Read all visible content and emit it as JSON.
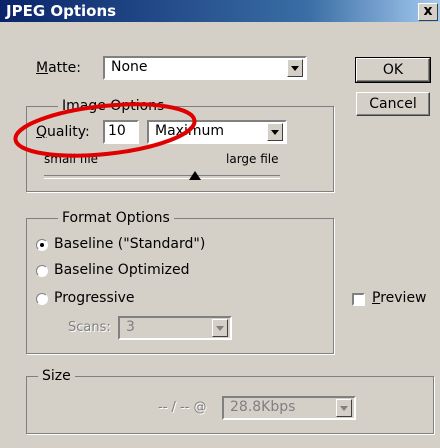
{
  "window": {
    "title": "JPEG Options",
    "close_glyph": "x"
  },
  "matte": {
    "label": "Matte:",
    "underline": "M",
    "rest": "atte:",
    "value": "None"
  },
  "buttons": {
    "ok": "OK",
    "cancel": "Cancel"
  },
  "image_options": {
    "title": "Image Options",
    "quality_underline": "Q",
    "quality_rest": "uality:",
    "quality_value": "10",
    "quality_preset": "Maximum",
    "slider_min_label": "small file",
    "slider_max_label": "large file",
    "slider_level": 0.64
  },
  "format_options": {
    "title": "Format Options",
    "options": [
      {
        "label": "Baseline (\"Standard\")",
        "selected": true
      },
      {
        "label": "Baseline Optimized",
        "selected": false
      },
      {
        "label": "Progressive",
        "selected": false
      }
    ],
    "scans_label": "Scans:",
    "scans_value": "3"
  },
  "preview": {
    "underline": "P",
    "rest": "review",
    "checked": false
  },
  "size": {
    "title": "Size",
    "estimate": "-- / -- @",
    "speed_value": "28.8Kbps"
  },
  "colors": {
    "title_bar": "#0a246a",
    "dialog_bg": "#d4d0c8",
    "annotation": "#e00000"
  }
}
